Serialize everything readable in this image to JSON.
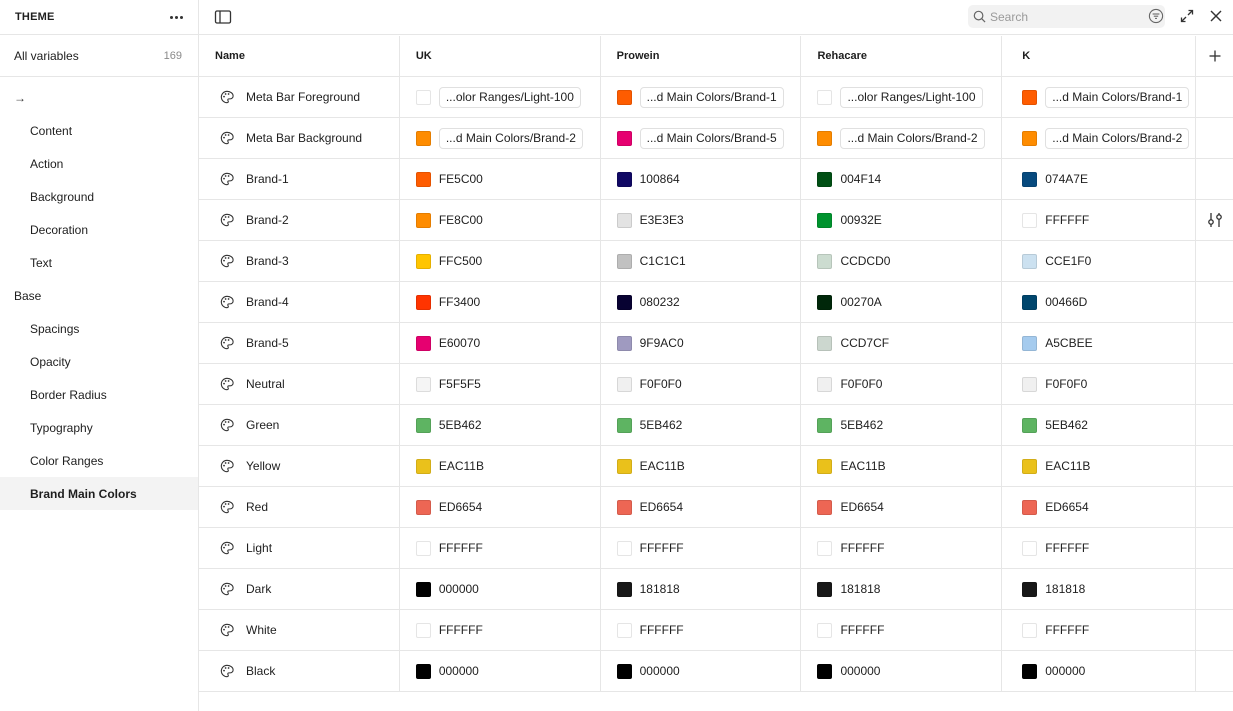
{
  "sidebar": {
    "title": "THEME",
    "all_variables_label": "All variables",
    "all_variables_count": "169",
    "items": [
      {
        "label": "→",
        "level": 0,
        "kind": "arrow"
      },
      {
        "label": "Content",
        "level": 1
      },
      {
        "label": "Action",
        "level": 1
      },
      {
        "label": "Background",
        "level": 1
      },
      {
        "label": "Decoration",
        "level": 1
      },
      {
        "label": "Text",
        "level": 1
      },
      {
        "label": "Base",
        "level": 0
      },
      {
        "label": "Spacings",
        "level": 1
      },
      {
        "label": "Opacity",
        "level": 1
      },
      {
        "label": "Border Radius",
        "level": 1
      },
      {
        "label": "Typography",
        "level": 1
      },
      {
        "label": "Color Ranges",
        "level": 1
      },
      {
        "label": "Brand Main Colors",
        "level": 1,
        "selected": true
      }
    ]
  },
  "search": {
    "placeholder": "Search"
  },
  "table": {
    "headers": [
      "Name",
      "UK",
      "Prowein",
      "Rehacare",
      "K"
    ],
    "rows": [
      {
        "name": "Meta Bar Foreground",
        "cells": [
          {
            "color": "#ffffff",
            "alias": "...olor Ranges/Light-100"
          },
          {
            "color": "#FE5C00",
            "alias": "...d Main Colors/Brand-1"
          },
          {
            "color": "#ffffff",
            "alias": "...olor Ranges/Light-100"
          },
          {
            "color": "#FE5C00",
            "alias": "...d Main Colors/Brand-1"
          }
        ]
      },
      {
        "name": "Meta Bar Background",
        "cells": [
          {
            "color": "#FE8C00",
            "alias": "...d Main Colors/Brand-2"
          },
          {
            "color": "#E60070",
            "alias": "...d Main Colors/Brand-5"
          },
          {
            "color": "#FE8C00",
            "alias": "...d Main Colors/Brand-2"
          },
          {
            "color": "#FE8C00",
            "alias": "...d Main Colors/Brand-2"
          }
        ]
      },
      {
        "name": "Brand-1",
        "cells": [
          {
            "color": "#FE5C00",
            "hex": "FE5C00"
          },
          {
            "color": "#100864",
            "hex": "100864"
          },
          {
            "color": "#004F14",
            "hex": "004F14"
          },
          {
            "color": "#074A7E",
            "hex": "074A7E"
          }
        ]
      },
      {
        "name": "Brand-2",
        "cells": [
          {
            "color": "#FE8C00",
            "hex": "FE8C00"
          },
          {
            "color": "#E3E3E3",
            "hex": "E3E3E3"
          },
          {
            "color": "#00932E",
            "hex": "00932E"
          },
          {
            "color": "#FFFFFF",
            "hex": "FFFFFF"
          }
        ]
      },
      {
        "name": "Brand-3",
        "cells": [
          {
            "color": "#FFC500",
            "hex": "FFC500"
          },
          {
            "color": "#C1C1C1",
            "hex": "C1C1C1"
          },
          {
            "color": "#CCDCD0",
            "hex": "CCDCD0"
          },
          {
            "color": "#CCE1F0",
            "hex": "CCE1F0"
          }
        ]
      },
      {
        "name": "Brand-4",
        "cells": [
          {
            "color": "#FF3400",
            "hex": "FF3400"
          },
          {
            "color": "#080232",
            "hex": "080232"
          },
          {
            "color": "#00270A",
            "hex": "00270A"
          },
          {
            "color": "#00466D",
            "hex": "00466D"
          }
        ]
      },
      {
        "name": "Brand-5",
        "cells": [
          {
            "color": "#E60070",
            "hex": "E60070"
          },
          {
            "color": "#9F9AC0",
            "hex": "9F9AC0"
          },
          {
            "color": "#CCD7CF",
            "hex": "CCD7CF"
          },
          {
            "color": "#A5CBEE",
            "hex": "A5CBEE"
          }
        ]
      },
      {
        "name": "Neutral",
        "cells": [
          {
            "color": "#F5F5F5",
            "hex": "F5F5F5"
          },
          {
            "color": "#F0F0F0",
            "hex": "F0F0F0"
          },
          {
            "color": "#F0F0F0",
            "hex": "F0F0F0"
          },
          {
            "color": "#F0F0F0",
            "hex": "F0F0F0"
          }
        ]
      },
      {
        "name": "Green",
        "cells": [
          {
            "color": "#5EB462",
            "hex": "5EB462"
          },
          {
            "color": "#5EB462",
            "hex": "5EB462"
          },
          {
            "color": "#5EB462",
            "hex": "5EB462"
          },
          {
            "color": "#5EB462",
            "hex": "5EB462"
          }
        ]
      },
      {
        "name": "Yellow",
        "cells": [
          {
            "color": "#EAC11B",
            "hex": "EAC11B"
          },
          {
            "color": "#EAC11B",
            "hex": "EAC11B"
          },
          {
            "color": "#EAC11B",
            "hex": "EAC11B"
          },
          {
            "color": "#EAC11B",
            "hex": "EAC11B"
          }
        ]
      },
      {
        "name": "Red",
        "cells": [
          {
            "color": "#ED6654",
            "hex": "ED6654"
          },
          {
            "color": "#ED6654",
            "hex": "ED6654"
          },
          {
            "color": "#ED6654",
            "hex": "ED6654"
          },
          {
            "color": "#ED6654",
            "hex": "ED6654"
          }
        ]
      },
      {
        "name": "Light",
        "cells": [
          {
            "color": "#FFFFFF",
            "hex": "FFFFFF"
          },
          {
            "color": "#FFFFFF",
            "hex": "FFFFFF"
          },
          {
            "color": "#FFFFFF",
            "hex": "FFFFFF"
          },
          {
            "color": "#FFFFFF",
            "hex": "FFFFFF"
          }
        ]
      },
      {
        "name": "Dark",
        "cells": [
          {
            "color": "#000000",
            "hex": "000000"
          },
          {
            "color": "#181818",
            "hex": "181818"
          },
          {
            "color": "#181818",
            "hex": "181818"
          },
          {
            "color": "#181818",
            "hex": "181818"
          }
        ]
      },
      {
        "name": "White",
        "cells": [
          {
            "color": "#FFFFFF",
            "hex": "FFFFFF"
          },
          {
            "color": "#FFFFFF",
            "hex": "FFFFFF"
          },
          {
            "color": "#FFFFFF",
            "hex": "FFFFFF"
          },
          {
            "color": "#FFFFFF",
            "hex": "FFFFFF"
          }
        ]
      },
      {
        "name": "Black",
        "cells": [
          {
            "color": "#000000",
            "hex": "000000"
          },
          {
            "color": "#000000",
            "hex": "000000"
          },
          {
            "color": "#000000",
            "hex": "000000"
          },
          {
            "color": "#000000",
            "hex": "000000"
          }
        ]
      }
    ]
  },
  "icons": {
    "more": "more-horizontal-icon",
    "sidebar_toggle": "sidebar-toggle-icon",
    "search": "search-icon",
    "filter": "filter-icon",
    "expand": "expand-icon",
    "close": "close-icon",
    "add_column": "plus-icon",
    "row_type": "palette-icon",
    "edit_modes": "sliders-icon"
  }
}
